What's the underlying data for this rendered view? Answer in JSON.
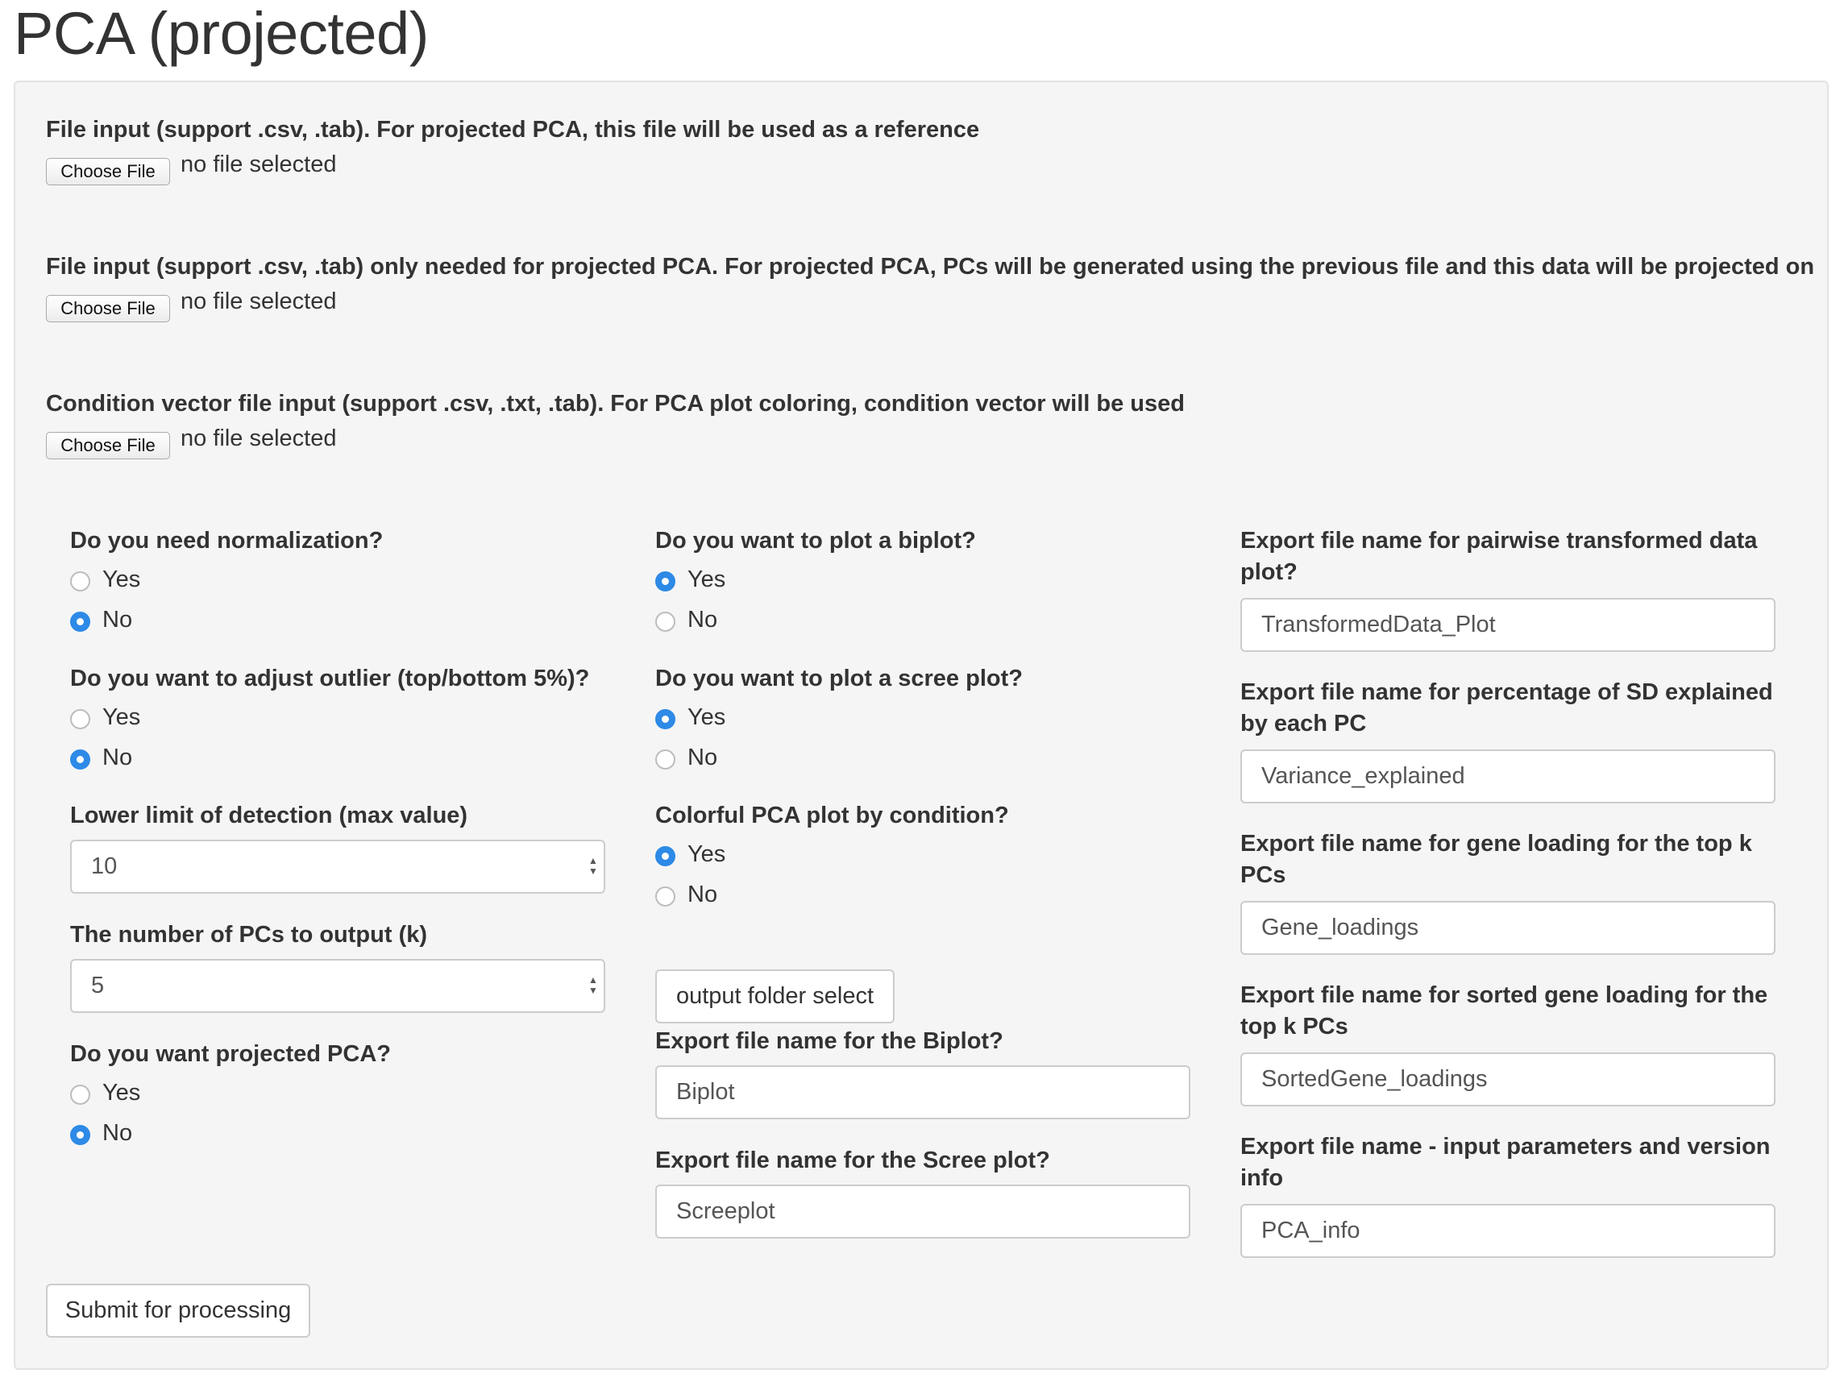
{
  "title": "PCA (projected)",
  "file_inputs": [
    {
      "label": "File input (support .csv, .tab). For projected PCA, this file will be used as a reference",
      "button": "Choose File",
      "status": "no file selected"
    },
    {
      "label": "File input (support .csv, .tab) only needed for projected PCA. For projected PCA, PCs will be generated using the previous file and this data will be projected on",
      "button": "Choose File",
      "status": "no file selected"
    },
    {
      "label": "Condition vector file input (support .csv, .txt, .tab). For PCA plot coloring, condition vector will be used",
      "button": "Choose File",
      "status": "no file selected"
    }
  ],
  "col1": {
    "normalization": {
      "label": "Do you need normalization?",
      "options": [
        "Yes",
        "No"
      ],
      "selected": "No"
    },
    "outlier": {
      "label": "Do you want to adjust outlier (top/bottom 5%)?",
      "options": [
        "Yes",
        "No"
      ],
      "selected": "No"
    },
    "lower_limit": {
      "label": "Lower limit of detection (max value)",
      "value": "10"
    },
    "num_pcs": {
      "label": "The number of PCs to output (k)",
      "value": "5"
    },
    "projected": {
      "label": "Do you want projected PCA?",
      "options": [
        "Yes",
        "No"
      ],
      "selected": "No"
    }
  },
  "col2": {
    "biplot": {
      "label": "Do you want to plot a biplot?",
      "options": [
        "Yes",
        "No"
      ],
      "selected": "Yes"
    },
    "scree": {
      "label": "Do you want to plot a scree plot?",
      "options": [
        "Yes",
        "No"
      ],
      "selected": "Yes"
    },
    "colorful": {
      "label": "Colorful PCA plot by condition?",
      "options": [
        "Yes",
        "No"
      ],
      "selected": "Yes"
    },
    "output_folder_button": "output folder select",
    "biplot_name": {
      "label": "Export file name for the Biplot?",
      "value": "Biplot"
    },
    "scree_name": {
      "label": "Export file name for the Scree plot?",
      "value": "Screeplot"
    }
  },
  "col3": {
    "transformed": {
      "label_1": "Export file name for pairwise transformed data",
      "label_2": "plot?",
      "value": "TransformedData_Plot"
    },
    "variance": {
      "label_1": "Export file name for percentage of SD explained",
      "label_2": "by each PC",
      "value": "Variance_explained"
    },
    "loadings": {
      "label_1": "Export file name for gene loading for the top k",
      "label_2": "PCs",
      "value": "Gene_loadings"
    },
    "sorted": {
      "label_1": "Export file name for sorted gene loading for the",
      "label_2": "top k PCs",
      "value": "SortedGene_loadings"
    },
    "info": {
      "label_1": "Export file name - input parameters and version",
      "label_2": "info",
      "value": "PCA_info"
    }
  },
  "submit_button": "Submit for processing",
  "colors": {
    "accent": "#2d8ae6",
    "panel_bg": "#f5f5f5",
    "text": "#333333"
  }
}
